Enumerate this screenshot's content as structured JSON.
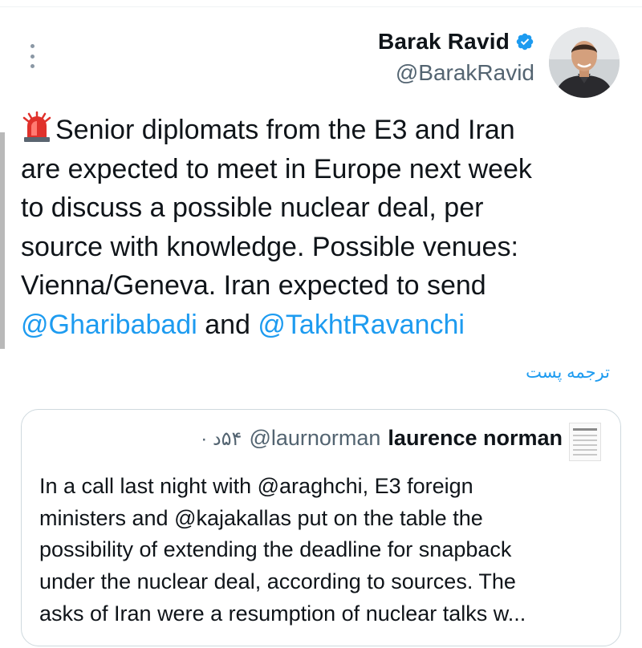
{
  "author": {
    "name": "Barak Ravid",
    "handle": "@BarakRavid"
  },
  "tweet": {
    "line1": "Senior diplomats from the E3 and Iran",
    "line2": "are expected to meet in Europe next week",
    "line3": "to discuss a possible nuclear deal, per",
    "line4": "source with knowledge. Possible venues:",
    "line5": "Vienna/Geneva. Iran expected to send",
    "mention1": "@Gharibabadi",
    "and": "and",
    "mention2": "@TakhtRavanchi"
  },
  "translate_label": "ترجمه پست",
  "quote": {
    "name": "laurence norman",
    "handle": "@laurnorman",
    "time": "۵۴د ·",
    "lines": [
      "In a call last night with @araghchi, E3 foreign",
      "ministers and @kajakallas put on the table the",
      "possibility of extending the deadline for snapback",
      "under the nuclear deal, according to sources. The",
      "asks of Iran were a resumption of nuclear talks w..."
    ]
  },
  "icons": {
    "more": "more-vertical-icon",
    "verified": "verified-badge-icon",
    "alert": "police-light-emoji"
  },
  "colors": {
    "link": "#1d9bf0",
    "text": "#0f1419",
    "secondary": "#536471",
    "verified": "#1d9bf0"
  }
}
